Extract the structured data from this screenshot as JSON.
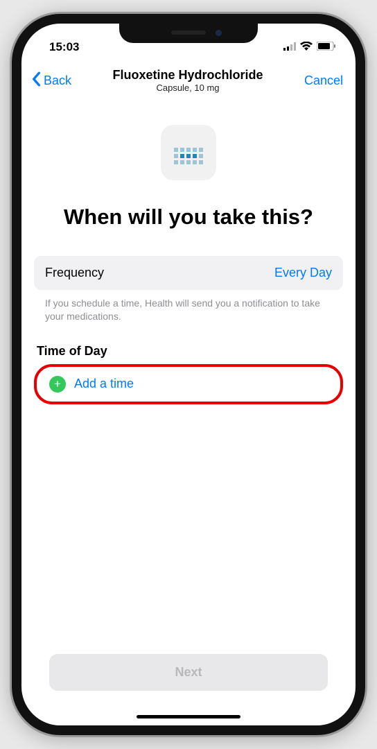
{
  "status_bar": {
    "time": "15:03"
  },
  "nav": {
    "back_label": "Back",
    "title": "Fluoxetine Hydrochloride",
    "subtitle": "Capsule, 10 mg",
    "cancel_label": "Cancel"
  },
  "main": {
    "heading": "When will you take this?",
    "frequency": {
      "label": "Frequency",
      "value": "Every Day"
    },
    "helper_text": "If you schedule a time, Health will send you a notification to take your medications.",
    "time_section_label": "Time of Day",
    "add_time_label": "Add a time",
    "next_label": "Next"
  }
}
